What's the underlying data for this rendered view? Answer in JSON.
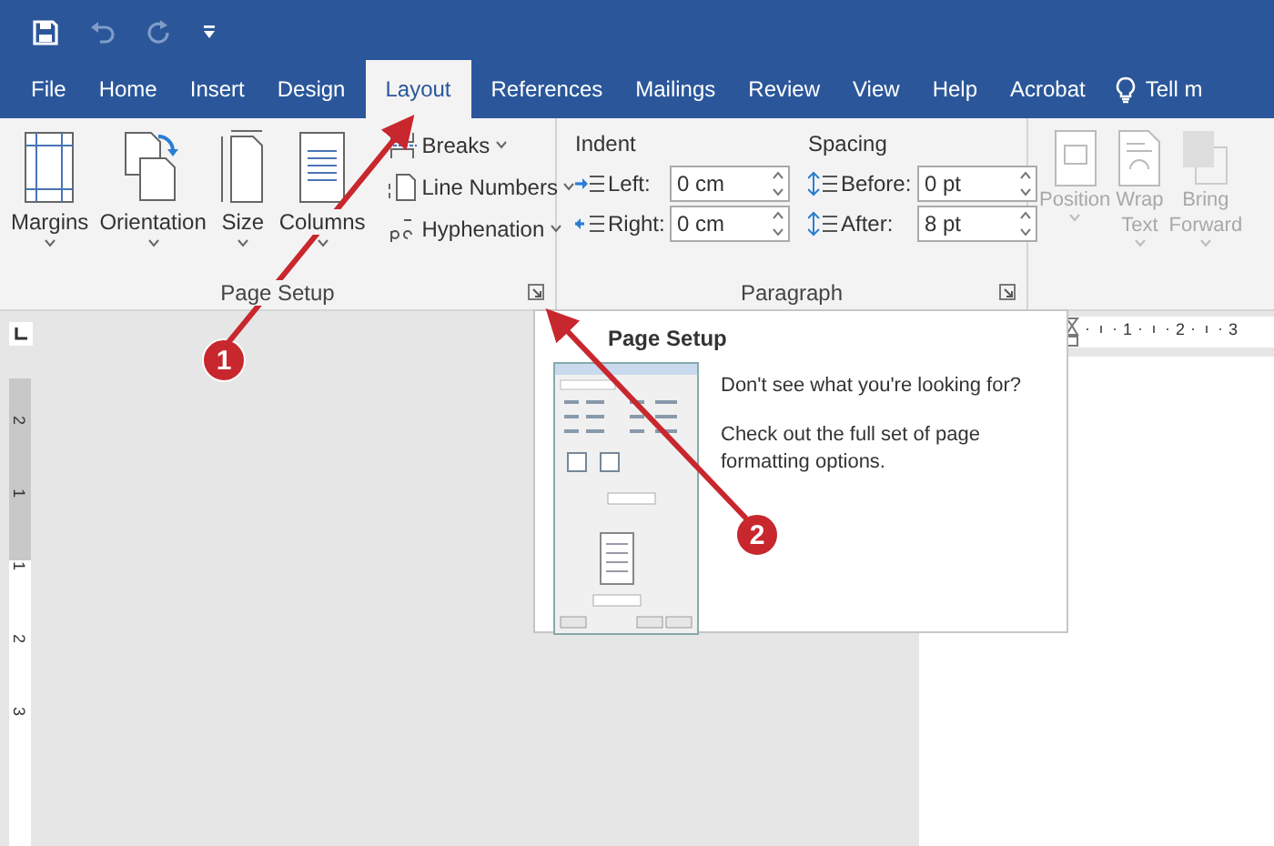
{
  "quick_access": [
    {
      "kind": "save",
      "disabled": false
    },
    {
      "kind": "undo",
      "disabled": true
    },
    {
      "kind": "redo",
      "disabled": true
    },
    {
      "kind": "customize",
      "disabled": false
    }
  ],
  "tabs": [
    {
      "label": "File",
      "selected": false
    },
    {
      "label": "Home",
      "selected": false
    },
    {
      "label": "Insert",
      "selected": false
    },
    {
      "label": "Design",
      "selected": false
    },
    {
      "label": "Layout",
      "selected": true
    },
    {
      "label": "References",
      "selected": false
    },
    {
      "label": "Mailings",
      "selected": false
    },
    {
      "label": "Review",
      "selected": false
    },
    {
      "label": "View",
      "selected": false
    },
    {
      "label": "Help",
      "selected": false
    },
    {
      "label": "Acrobat",
      "selected": false
    }
  ],
  "tell_me": "Tell m",
  "page_setup": {
    "label": "Page Setup",
    "large_buttons": [
      {
        "label": "Margins",
        "kind": "margins"
      },
      {
        "label": "Orientation",
        "kind": "orientation"
      },
      {
        "label": "Size",
        "kind": "size"
      },
      {
        "label": "Columns",
        "kind": "columns"
      }
    ],
    "small_buttons": [
      {
        "label": "Breaks",
        "kind": "breaks"
      },
      {
        "label": "Line Numbers",
        "kind": "line-numbers"
      },
      {
        "label": "Hyphenation",
        "kind": "hyphenation"
      }
    ]
  },
  "paragraph": {
    "label": "Paragraph",
    "sections": [
      {
        "heading": "Indent",
        "fields": [
          {
            "label": "Left:",
            "value": "0 cm",
            "kind": "indent-left"
          },
          {
            "label": "Right:",
            "value": "0 cm",
            "kind": "indent-right"
          }
        ]
      },
      {
        "heading": "Spacing",
        "fields": [
          {
            "label": "Before:",
            "value": "0 pt",
            "kind": "space-before"
          },
          {
            "label": "After:",
            "value": "8 pt",
            "kind": "space-after"
          }
        ]
      }
    ]
  },
  "arrange": {
    "disabled": true,
    "buttons": [
      {
        "lines": [
          "Position"
        ],
        "kind": "position"
      },
      {
        "lines": [
          "Wrap",
          "Text"
        ],
        "kind": "wrap"
      },
      {
        "lines": [
          "Bring",
          "Forward"
        ],
        "kind": "bring"
      }
    ]
  },
  "tooltip": {
    "title": "Page Setup",
    "lines": [
      "Don't see what you're looking for?",
      "Check out the full set of page formatting options."
    ]
  },
  "rulers": {
    "horizontal": [
      "1",
      "2",
      "3"
    ],
    "vertical": [
      "2",
      "1",
      "1",
      "2",
      "3"
    ]
  },
  "annotations": [
    {
      "label": "1"
    },
    {
      "label": "2"
    }
  ]
}
